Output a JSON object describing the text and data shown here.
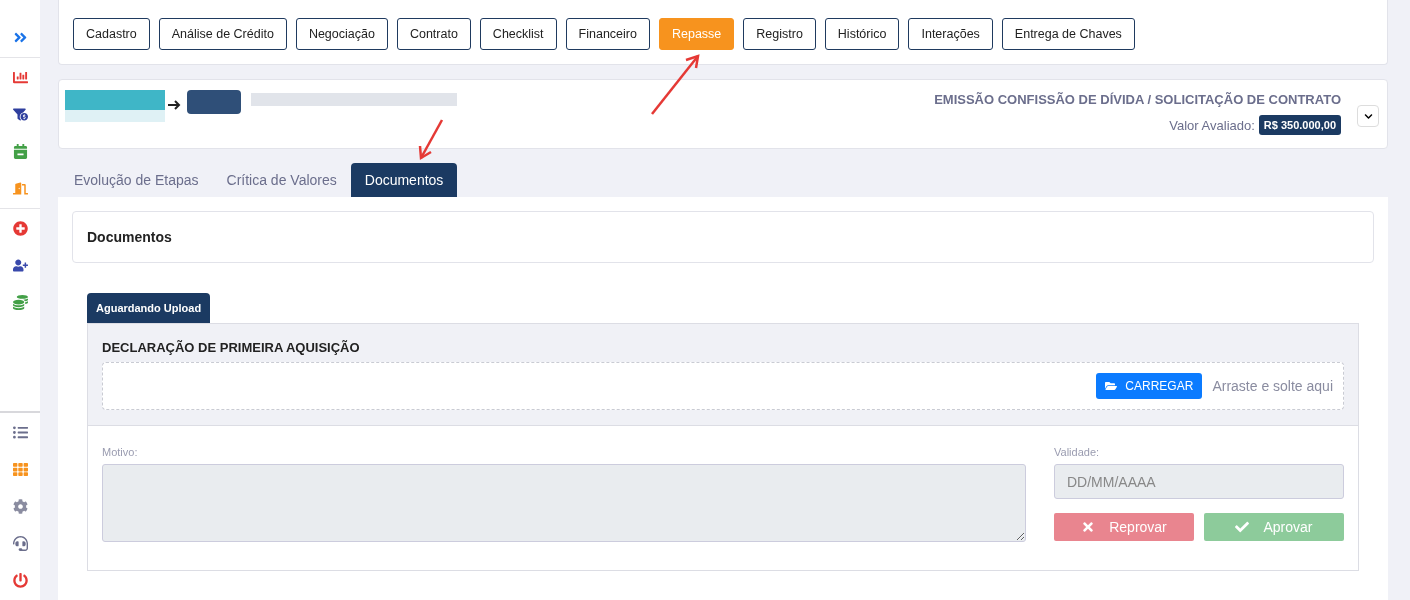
{
  "stage_buttons": [
    {
      "label": "Cadastro",
      "selected": false
    },
    {
      "label": "Análise de Crédito",
      "selected": false
    },
    {
      "label": "Negociação",
      "selected": false
    },
    {
      "label": "Contrato",
      "selected": false
    },
    {
      "label": "Checklist",
      "selected": false
    },
    {
      "label": "Financeiro",
      "selected": false
    },
    {
      "label": "Repasse",
      "selected": true
    },
    {
      "label": "Registro",
      "selected": false
    },
    {
      "label": "Histórico",
      "selected": false
    },
    {
      "label": "Interações",
      "selected": false
    },
    {
      "label": "Entrega de Chaves",
      "selected": false
    }
  ],
  "summary": {
    "stage_title": "EMISSÃO CONFISSÃO DE DÍVIDA / SOLICITAÇÃO DE CONTRATO",
    "value_label": "Valor Avaliado:",
    "value": "R$ 350.000,00",
    "expanded": false
  },
  "tabs": [
    {
      "label": "Evolução de Etapas",
      "selected": false
    },
    {
      "label": "Crítica de Valores",
      "selected": false
    },
    {
      "label": "Documentos",
      "selected": true
    }
  ],
  "documents": {
    "title": "Documentos",
    "status_tabs": [
      {
        "label": "Aguardando Upload",
        "selected": true
      }
    ],
    "item": {
      "name": "DECLARAÇÃO DE PRIMEIRA AQUISIÇÃO",
      "upload_button": "CARREGAR",
      "drop_hint": "Arraste e solte aqui",
      "reason_label": "Motivo:",
      "reason_disabled": true,
      "validity_label": "Validade:",
      "validity_placeholder": "DD/MM/AAAA",
      "validity_disabled": true,
      "reject_button": {
        "label": "Reprovar",
        "disabled": true
      },
      "approve_button": {
        "label": "Aprovar",
        "disabled": true
      }
    }
  }
}
